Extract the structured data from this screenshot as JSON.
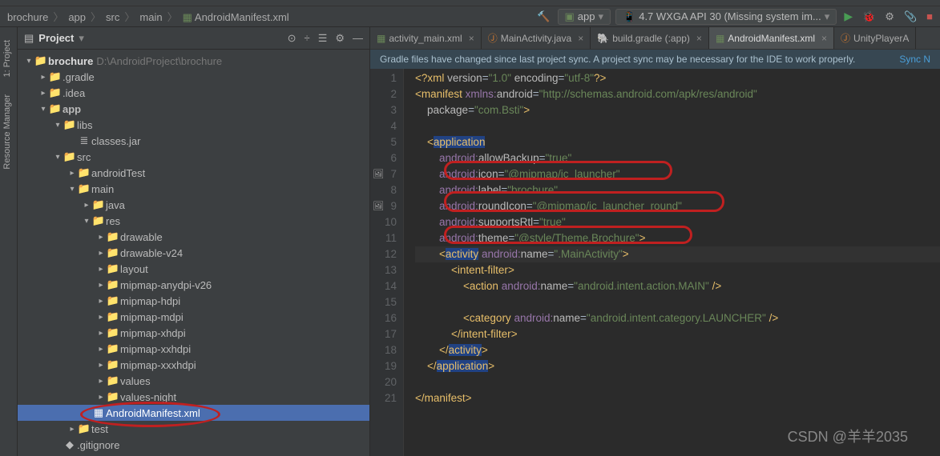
{
  "breadcrumb": [
    "brochure",
    "app",
    "src",
    "main",
    "AndroidManifest.xml"
  ],
  "config": {
    "run": "app",
    "device": "4.7  WXGA API 30 (Missing system im..."
  },
  "sidetabs": [
    "1: Project",
    "Resource Manager"
  ],
  "project_title": "Project",
  "root": {
    "name": "brochure",
    "path": "D:\\AndroidProject\\brochure"
  },
  "tree": [
    {
      "d": 1,
      "ic": "fold-orange",
      "exp": true,
      "label": "brochure",
      "path": "D:\\AndroidProject\\brochure",
      "root": true
    },
    {
      "d": 2,
      "ic": "fold-orange",
      "exp": false,
      "label": ".gradle"
    },
    {
      "d": 2,
      "ic": "fold-orange",
      "exp": false,
      "label": ".idea"
    },
    {
      "d": 2,
      "ic": "fold-blue",
      "exp": true,
      "label": "app",
      "bold": true
    },
    {
      "d": 3,
      "ic": "fold-gray",
      "exp": true,
      "label": "libs"
    },
    {
      "d": 4,
      "ic": "jar",
      "label": "classes.jar"
    },
    {
      "d": 3,
      "ic": "fold-blue",
      "exp": true,
      "label": "src"
    },
    {
      "d": 4,
      "ic": "fold-gray",
      "exp": false,
      "label": "androidTest"
    },
    {
      "d": 4,
      "ic": "fold-gray",
      "exp": true,
      "label": "main"
    },
    {
      "d": 5,
      "ic": "fold-blue",
      "exp": false,
      "label": "java"
    },
    {
      "d": 5,
      "ic": "fold-blue",
      "exp": true,
      "label": "res"
    },
    {
      "d": 6,
      "ic": "fold-gray",
      "exp": false,
      "label": "drawable"
    },
    {
      "d": 6,
      "ic": "fold-gray",
      "exp": false,
      "label": "drawable-v24"
    },
    {
      "d": 6,
      "ic": "fold-gray",
      "exp": false,
      "label": "layout"
    },
    {
      "d": 6,
      "ic": "fold-gray",
      "exp": false,
      "label": "mipmap-anydpi-v26"
    },
    {
      "d": 6,
      "ic": "fold-gray",
      "exp": false,
      "label": "mipmap-hdpi"
    },
    {
      "d": 6,
      "ic": "fold-gray",
      "exp": false,
      "label": "mipmap-mdpi"
    },
    {
      "d": 6,
      "ic": "fold-gray",
      "exp": false,
      "label": "mipmap-xhdpi"
    },
    {
      "d": 6,
      "ic": "fold-gray",
      "exp": false,
      "label": "mipmap-xxhdpi"
    },
    {
      "d": 6,
      "ic": "fold-gray",
      "exp": false,
      "label": "mipmap-xxxhdpi"
    },
    {
      "d": 6,
      "ic": "fold-gray",
      "exp": false,
      "label": "values"
    },
    {
      "d": 6,
      "ic": "fold-gray",
      "exp": false,
      "label": "values-night"
    },
    {
      "d": 5,
      "ic": "xml",
      "label": "AndroidManifest.xml",
      "sel": true
    },
    {
      "d": 4,
      "ic": "fold-gray",
      "exp": false,
      "label": "test"
    },
    {
      "d": 3,
      "ic": "git",
      "label": ".gitignore"
    }
  ],
  "tabs": [
    {
      "label": "activity_main.xml",
      "ic": "xml"
    },
    {
      "label": "MainActivity.java",
      "ic": "java"
    },
    {
      "label": "build.gradle (:app)",
      "ic": "gradle"
    },
    {
      "label": "AndroidManifest.xml",
      "ic": "xml",
      "active": true
    },
    {
      "label": "UnityPlayerA",
      "ic": "java",
      "noclose": true
    }
  ],
  "banner": {
    "msg": "Gradle files have changed since last project sync. A project sync may be necessary for the IDE to work properly.",
    "link": "Sync N"
  },
  "code": {
    "lines": [
      {
        "n": 1,
        "seg": [
          [
            "br",
            "<?"
          ],
          [
            "t-tag",
            "xml "
          ],
          [
            "t-attr",
            "version"
          ],
          [
            "t-text",
            "="
          ],
          [
            "t-str",
            "\"1.0\""
          ],
          [
            "t-attr",
            " encoding"
          ],
          [
            "t-text",
            "="
          ],
          [
            "t-str",
            "\"utf-8\""
          ],
          [
            "br",
            "?>"
          ]
        ]
      },
      {
        "n": 2,
        "seg": [
          [
            "br",
            "<"
          ],
          [
            "t-tag",
            "manifest "
          ],
          [
            "t-ns",
            "xmlns:"
          ],
          [
            "t-attr",
            "android"
          ],
          [
            "t-text",
            "="
          ],
          [
            "t-str",
            "\"http://schemas.android.com/apk/res/android\""
          ]
        ]
      },
      {
        "n": 3,
        "seg": [
          [
            "",
            "    "
          ],
          [
            "t-attr",
            "package"
          ],
          [
            "t-text",
            "="
          ],
          [
            "t-str",
            "\"com.Bsti\""
          ],
          [
            "br",
            ">"
          ]
        ]
      },
      {
        "n": 4,
        "seg": []
      },
      {
        "n": 5,
        "seg": [
          [
            "",
            "    "
          ],
          [
            "br",
            "<"
          ],
          [
            "t-tag hl",
            "application"
          ]
        ]
      },
      {
        "n": 6,
        "seg": [
          [
            "",
            "        "
          ],
          [
            "t-ns",
            "android:"
          ],
          [
            "t-attr",
            "allowBackup"
          ],
          [
            "t-text",
            "="
          ],
          [
            "t-str",
            "\"true\""
          ]
        ]
      },
      {
        "n": 7,
        "seg": [
          [
            "",
            "        "
          ],
          [
            "t-ns",
            "android:"
          ],
          [
            "t-attr",
            "icon"
          ],
          [
            "t-text",
            "="
          ],
          [
            "t-str",
            "\"@mipmap/ic_launcher\""
          ]
        ],
        "gic": "🖼"
      },
      {
        "n": 8,
        "seg": [
          [
            "",
            "        "
          ],
          [
            "t-ns",
            "android:"
          ],
          [
            "t-attr",
            "label"
          ],
          [
            "t-text",
            "="
          ],
          [
            "t-str",
            "\"brochure\""
          ]
        ]
      },
      {
        "n": 9,
        "seg": [
          [
            "",
            "        "
          ],
          [
            "t-ns",
            "android:"
          ],
          [
            "t-attr",
            "roundIcon"
          ],
          [
            "t-text",
            "="
          ],
          [
            "t-str",
            "\"@mipmap/ic_launcher_round\""
          ]
        ],
        "gic": "🖼"
      },
      {
        "n": 10,
        "seg": [
          [
            "",
            "        "
          ],
          [
            "t-ns",
            "android:"
          ],
          [
            "t-attr",
            "supportsRtl"
          ],
          [
            "t-text",
            "="
          ],
          [
            "t-str",
            "\"true\""
          ]
        ]
      },
      {
        "n": 11,
        "seg": [
          [
            "",
            "        "
          ],
          [
            "t-ns",
            "android:"
          ],
          [
            "t-attr",
            "theme"
          ],
          [
            "t-text",
            "="
          ],
          [
            "t-str",
            "\"@style/Theme.Brochure\""
          ],
          [
            "br",
            ">"
          ]
        ]
      },
      {
        "n": 12,
        "caret": true,
        "seg": [
          [
            "",
            "        "
          ],
          [
            "br",
            "<"
          ],
          [
            "t-tag hl",
            "activity"
          ],
          [
            "t-text",
            " "
          ],
          [
            "t-ns",
            "android:"
          ],
          [
            "t-attr",
            "name"
          ],
          [
            "t-text",
            "="
          ],
          [
            "t-str",
            "\".MainActivity\""
          ],
          [
            "br",
            ">"
          ]
        ]
      },
      {
        "n": 13,
        "seg": [
          [
            "",
            "            "
          ],
          [
            "br",
            "<"
          ],
          [
            "t-tag",
            "intent-filter"
          ],
          [
            "br",
            ">"
          ]
        ]
      },
      {
        "n": 14,
        "seg": [
          [
            "",
            "                "
          ],
          [
            "br",
            "<"
          ],
          [
            "t-tag",
            "action "
          ],
          [
            "t-ns",
            "android:"
          ],
          [
            "t-attr",
            "name"
          ],
          [
            "t-text",
            "="
          ],
          [
            "t-str",
            "\"android.intent.action.MAIN\""
          ],
          [
            "br",
            " />"
          ]
        ]
      },
      {
        "n": 15,
        "seg": []
      },
      {
        "n": 16,
        "seg": [
          [
            "",
            "                "
          ],
          [
            "br",
            "<"
          ],
          [
            "t-tag",
            "category "
          ],
          [
            "t-ns",
            "android:"
          ],
          [
            "t-attr",
            "name"
          ],
          [
            "t-text",
            "="
          ],
          [
            "t-str",
            "\"android.intent.category.LAUNCHER\""
          ],
          [
            "br",
            " />"
          ]
        ]
      },
      {
        "n": 17,
        "seg": [
          [
            "",
            "            "
          ],
          [
            "br",
            "</"
          ],
          [
            "t-tag",
            "intent-filter"
          ],
          [
            "br",
            ">"
          ]
        ]
      },
      {
        "n": 18,
        "seg": [
          [
            "",
            "        "
          ],
          [
            "br",
            "</"
          ],
          [
            "t-tag hl",
            "activity"
          ],
          [
            "br",
            ">"
          ]
        ]
      },
      {
        "n": 19,
        "seg": [
          [
            "",
            "    "
          ],
          [
            "br",
            "</"
          ],
          [
            "t-tag hl",
            "application"
          ],
          [
            "br",
            ">"
          ]
        ]
      },
      {
        "n": 20,
        "seg": []
      },
      {
        "n": 21,
        "seg": [
          [
            "br",
            "</"
          ],
          [
            "t-tag",
            "manifest"
          ],
          [
            "br",
            ">"
          ]
        ]
      }
    ]
  },
  "watermark": "CSDN @羊羊2035"
}
